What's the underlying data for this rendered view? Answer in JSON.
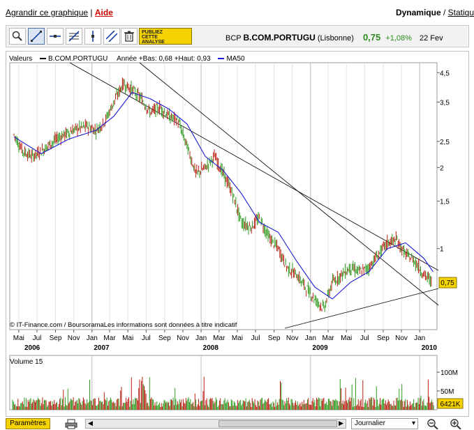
{
  "top": {
    "enlarge": "Agrandir ce graphique",
    "separator": "|",
    "help": "Aide",
    "mode_dynamic": "Dynamique",
    "mode_sep": " / ",
    "mode_static": "Statiqu"
  },
  "ticker": {
    "code": "BCP",
    "name": "B.COM.PORTUGU",
    "market": "(Lisbonne)",
    "price": "0,75",
    "change": "+1,08%",
    "date": "22 Fev"
  },
  "publish_badge": [
    "PUBLIEZ",
    "CETTE",
    "ANALYSE"
  ],
  "legend": {
    "values_label": "Valeurs",
    "series1": "B.COM.PORTUGU",
    "year_info": "Année +Bas: 0,68 +Haut: 0,93",
    "series2": "MA50",
    "series1_color": "#000000",
    "series2_color": "#1a1ad6"
  },
  "credit": "© IT-Finance.com / BoursoramaLes informations sont données à titre indicatif",
  "volume_label": "Volume 15",
  "price_tag": "0,75",
  "volume_tag": "6421K",
  "chart_data": {
    "type": "line",
    "scale": "log",
    "y_ticks": [
      "4,5",
      "3,5",
      "2,5",
      "2",
      "1,5",
      "1"
    ],
    "x_month_labels": [
      "Mai",
      "Jul",
      "Sep",
      "Nov",
      "Jan",
      "Mar",
      "Mai",
      "Jul",
      "Sep",
      "Nov",
      "Jan",
      "Mar",
      "Mai",
      "Jul",
      "Sep",
      "Nov",
      "Jan",
      "Mar",
      "Mai",
      "Jul",
      "Sep",
      "Nov",
      "Jan"
    ],
    "x_year_labels": [
      "2006",
      "2007",
      "2008",
      "2009",
      "2010"
    ],
    "series": [
      {
        "name": "B.COM.PORTUGU",
        "dates": [
          "2006-04",
          "2006-05",
          "2006-06",
          "2006-07",
          "2006-08",
          "2006-09",
          "2006-10",
          "2006-11",
          "2006-12",
          "2007-01",
          "2007-02",
          "2007-03",
          "2007-04",
          "2007-05",
          "2007-06",
          "2007-07",
          "2007-08",
          "2007-09",
          "2007-10",
          "2007-11",
          "2007-12",
          "2008-01",
          "2008-02",
          "2008-03",
          "2008-04",
          "2008-05",
          "2008-06",
          "2008-07",
          "2008-08",
          "2008-09",
          "2008-10",
          "2008-11",
          "2008-12",
          "2009-01",
          "2009-02",
          "2009-03",
          "2009-04",
          "2009-05",
          "2009-06",
          "2009-07",
          "2009-08",
          "2009-09",
          "2009-10",
          "2009-11",
          "2009-12",
          "2010-01",
          "2010-02"
        ],
        "values": [
          2.65,
          2.3,
          2.2,
          2.3,
          2.45,
          2.6,
          2.7,
          2.8,
          2.85,
          2.75,
          3.0,
          3.5,
          4.1,
          3.9,
          3.6,
          3.2,
          3.35,
          3.1,
          3.0,
          2.4,
          1.9,
          2.0,
          2.2,
          1.9,
          1.6,
          1.25,
          1.2,
          1.3,
          1.1,
          1.0,
          0.85,
          0.8,
          0.72,
          0.65,
          0.6,
          0.75,
          0.8,
          0.85,
          0.82,
          0.85,
          0.95,
          1.05,
          1.08,
          0.95,
          0.9,
          0.8,
          0.75
        ]
      },
      {
        "name": "MA50",
        "dates": [
          "2006-04",
          "2006-07",
          "2006-10",
          "2007-01",
          "2007-03",
          "2007-05",
          "2007-07",
          "2007-09",
          "2007-11",
          "2008-01",
          "2008-03",
          "2008-05",
          "2008-07",
          "2008-09",
          "2008-11",
          "2009-01",
          "2009-03",
          "2009-05",
          "2009-07",
          "2009-09",
          "2009-11",
          "2010-01",
          "2010-02"
        ],
        "values": [
          2.6,
          2.25,
          2.55,
          2.75,
          3.1,
          3.8,
          3.6,
          3.3,
          2.9,
          2.2,
          1.95,
          1.6,
          1.25,
          1.15,
          0.9,
          0.72,
          0.65,
          0.75,
          0.82,
          1.0,
          1.05,
          0.92,
          0.82
        ]
      }
    ],
    "volume": {
      "label": "Volume 15",
      "y_ticks": [
        "100M",
        "50M"
      ]
    },
    "grid": true
  }
}
